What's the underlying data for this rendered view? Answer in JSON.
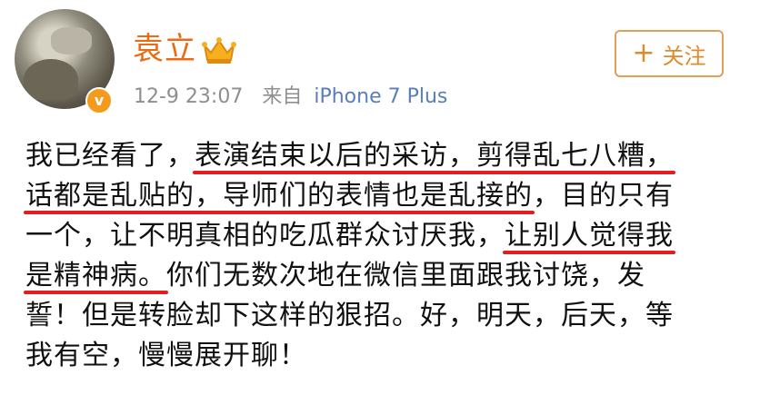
{
  "post": {
    "author_name": "袁立",
    "timestamp": "12-9 23:07",
    "source_prefix": "来自",
    "device": "iPhone 7 Plus",
    "verified_badge": "v",
    "follow_icon": "+",
    "follow_label": "关注",
    "accent_color": "#eb6a12",
    "underline_color": "#e21d1d",
    "body": {
      "l1a": "我已经看了，",
      "l1b": "表演结束以后的采访，剪得乱七八糟，",
      "l2a": "话都是乱贴的，导师们的表情也是乱接的",
      "l2b": "，目的只有",
      "l3a": "一个，让不明真相的吃瓜群众讨厌我，",
      "l3b": "让别人觉得我",
      "l4a": "是精神病。",
      "l4b": "你们无数次地在微信里面跟我讨饶，发",
      "l5": "誓！但是转脸却下这样的狠招。好，明天，后天，等",
      "l6": "我有空，慢慢展开聊！"
    }
  }
}
